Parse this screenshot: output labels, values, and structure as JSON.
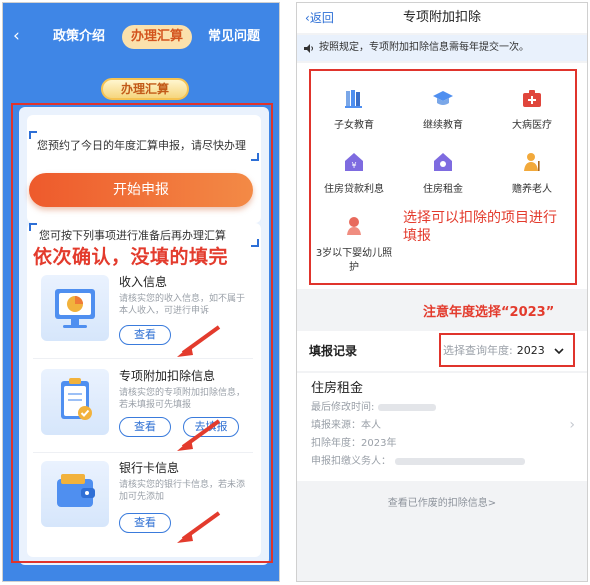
{
  "left": {
    "back_icon": "chevron-left-icon",
    "tabs": [
      "政策介绍",
      "办理汇算",
      "常见问题"
    ],
    "section_pill": "办理汇算",
    "notice": "您预约了今日的年度汇算申报，请尽快办理",
    "start_button": "开始申报",
    "prep_text": "您可按下列事项进行准备后再办理汇算",
    "annotation": "依次确认，没填的填完",
    "items": [
      {
        "title": "收入信息",
        "desc": "请核实您的收入信息，如不属于本人收入，可进行申诉",
        "view": "查看",
        "fill": ""
      },
      {
        "title": "专项附加扣除信息",
        "desc": "请核实您的专项附加扣除信息，若未填报可先填报",
        "view": "查看",
        "fill": "去填报"
      },
      {
        "title": "银行卡信息",
        "desc": "请核实您的银行卡信息，若未添加可先添加",
        "view": "查看",
        "fill": ""
      }
    ],
    "colors": {
      "bg": "#3f86e6",
      "accent": "#ee5a2c",
      "annotation": "#e33b2d"
    }
  },
  "right": {
    "back_label": "返回",
    "title": "专项附加扣除",
    "notice": "按照规定，专项附加扣除信息需每年提交一次。",
    "categories": [
      {
        "label": "子女教育",
        "icon": "children-education-icon"
      },
      {
        "label": "继续教育",
        "icon": "graduation-cap-icon"
      },
      {
        "label": "大病医疗",
        "icon": "medical-kit-icon"
      },
      {
        "label": "住房贷款利息",
        "icon": "house-loan-icon"
      },
      {
        "label": "住房租金",
        "icon": "house-rent-icon"
      },
      {
        "label": "赡养老人",
        "icon": "elderly-care-icon"
      },
      {
        "label": "3岁以下婴幼儿照护",
        "icon": "infant-care-icon"
      }
    ],
    "annotation_select": "选择可以扣除的项目进行填报",
    "annotation_year": "注意年度选择“2023”",
    "record_title": "填报记录",
    "year_select_label": "选择查询年度:",
    "year_select_value": "2023",
    "record": {
      "name": "住房租金",
      "modified_label": "最后修改时间:",
      "source_label": "填报来源：",
      "source_value": "本人",
      "year_label": "扣除年度：",
      "year_value": "2023年",
      "agent_label": "申报扣缴义务人："
    },
    "void_link": "查看已作废的扣除信息>"
  }
}
